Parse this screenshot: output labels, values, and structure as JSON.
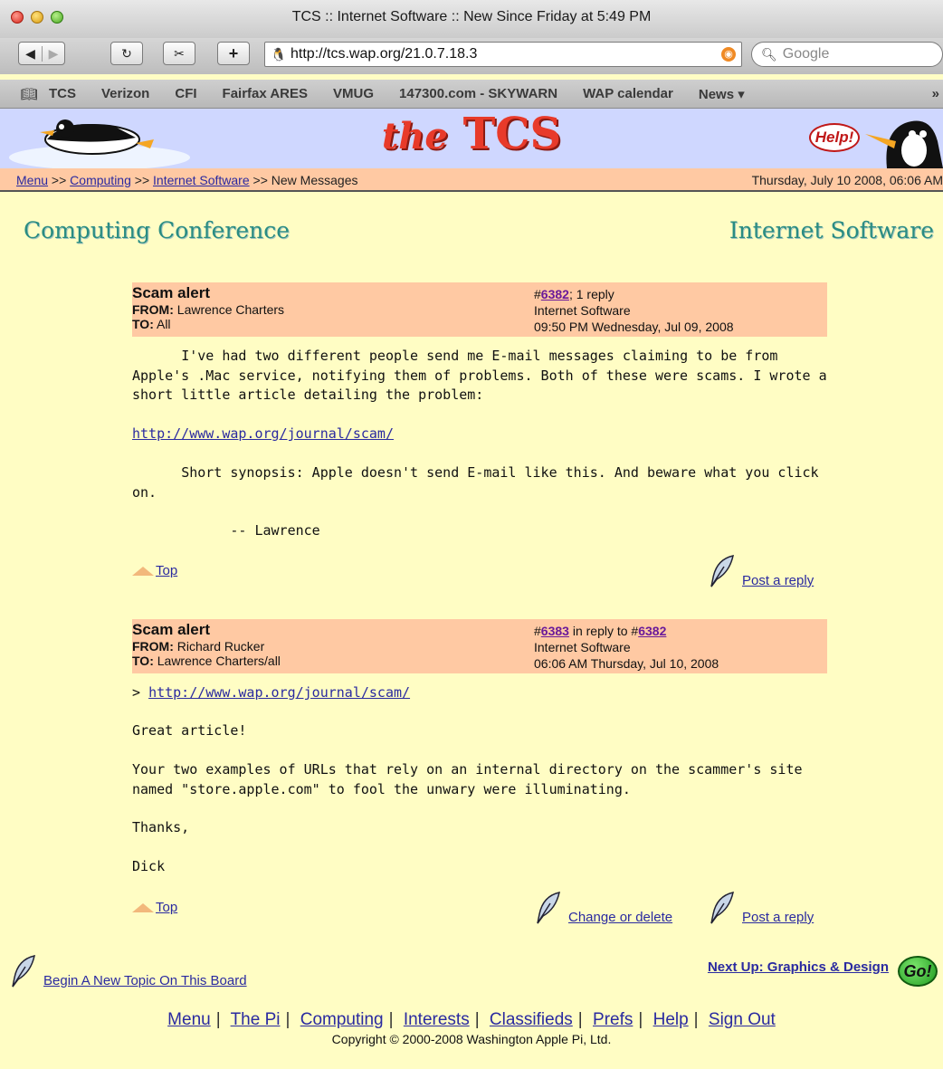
{
  "window": {
    "title": "TCS :: Internet Software :: New Since Friday at 5:49 PM"
  },
  "toolbar": {
    "url": "http://tcs.wap.org/21.0.7.18.3",
    "search_placeholder": "Google",
    "plus_label": "+"
  },
  "bookmarks": [
    "TCS",
    "Verizon",
    "CFI",
    "Fairfax ARES",
    "VMUG",
    "147300.com - SKYWARN",
    "WAP calendar",
    "News ▾"
  ],
  "banner": {
    "logo_small": "the",
    "logo_big": "TCS",
    "help": "Help!"
  },
  "breadcrumb": {
    "items": [
      "Menu",
      "Computing",
      "Internet Software"
    ],
    "sep": ">>",
    "current": "New Messages",
    "date": "Thursday, July 10 2008, 06:06 AM"
  },
  "sections": {
    "left": "Computing Conference",
    "right": "Internet Software"
  },
  "messages": [
    {
      "subject": "Scam alert",
      "from_label": "FROM:",
      "from": "Lawrence Charters",
      "to_label": "TO:",
      "to": "All",
      "num_prefix": "#",
      "num": "6382",
      "reply_info": "; 1 reply",
      "board": "Internet Software",
      "timestamp": "09:50 PM Wednesday, Jul 09, 2008",
      "p1": "      I've had two different people send me E-mail messages claiming to be from Apple's .Mac service, notifying them of problems. Both of these were scams. I wrote a short little article detailing the problem:",
      "link": "http://www.wap.org/journal/scam/",
      "p2": "      Short synopsis: Apple doesn't send E-mail like this. And beware what you click on.",
      "p3": "            -- Lawrence",
      "top": "Top",
      "reply": "Post a reply"
    },
    {
      "subject": "Scam alert",
      "from_label": "FROM:",
      "from": "Richard Rucker",
      "to_label": "TO:",
      "to": "Lawrence Charters/all",
      "num_prefix": "#",
      "num": "6383",
      "reply_info": " in reply to #",
      "reply_num": "6382",
      "board": "Internet Software",
      "timestamp": "06:06 AM Thursday, Jul 10, 2008",
      "quote_prefix": "> ",
      "link": "http://www.wap.org/journal/scam/",
      "p1": "Great article!",
      "p2": "Your two examples of URLs that rely on an internal directory on the scammer's site named \"store.apple.com\" to fool the unwary were illuminating.",
      "p3": "Thanks,",
      "p4": "Dick",
      "top": "Top",
      "change": "Change or delete",
      "reply": "Post a reply"
    }
  ],
  "new_topic": "Begin A New Topic On This Board",
  "next_up": "Next Up: Graphics & Design",
  "go": "Go!",
  "footer_links": [
    "Menu",
    "The Pi",
    "Computing",
    "Interests",
    "Classifieds",
    "Prefs",
    "Help",
    "Sign Out"
  ],
  "copyright": "Copyright © 2000-2008 Washington Apple Pi, Ltd."
}
